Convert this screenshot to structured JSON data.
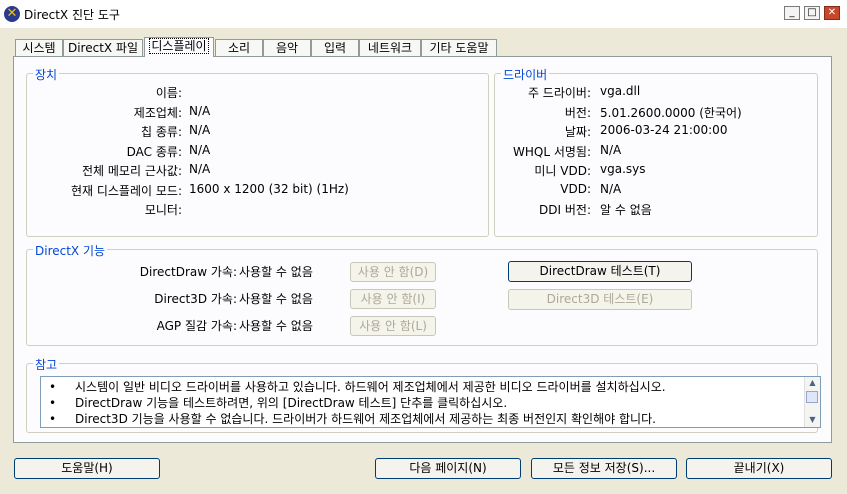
{
  "window": {
    "title": "DirectX 진단 도구",
    "controls": {
      "minimize": "_",
      "maximize": "□",
      "close": "✕"
    }
  },
  "tabs": [
    {
      "label": "시스템"
    },
    {
      "label": "DirectX 파일"
    },
    {
      "label": "디스플레이",
      "active": true
    },
    {
      "label": "소리"
    },
    {
      "label": "음악"
    },
    {
      "label": "입력"
    },
    {
      "label": "네트워크"
    },
    {
      "label": "기타 도움말"
    }
  ],
  "device": {
    "title": "장치",
    "rows": [
      {
        "label": "이름:",
        "value": ""
      },
      {
        "label": "제조업체:",
        "value": "N/A"
      },
      {
        "label": "칩 종류:",
        "value": "N/A"
      },
      {
        "label": "DAC 종류:",
        "value": "N/A"
      },
      {
        "label": "전체 메모리 근사값:",
        "value": "N/A"
      },
      {
        "label": "현재 디스플레이 모드:",
        "value": "1600 x 1200 (32 bit) (1Hz)"
      },
      {
        "label": "모니터:",
        "value": ""
      }
    ]
  },
  "driver": {
    "title": "드라이버",
    "rows": [
      {
        "label": "주 드라이버:",
        "value": "vga.dll"
      },
      {
        "label": "버전:",
        "value": "5.01.2600.0000 (한국어)"
      },
      {
        "label": "날짜:",
        "value": "2006-03-24 21:00:00"
      },
      {
        "label": "WHQL 서명됨:",
        "value": "N/A"
      },
      {
        "label": "미니 VDD:",
        "value": "vga.sys"
      },
      {
        "label": "VDD:",
        "value": "N/A"
      },
      {
        "label": "DDI 버전:",
        "value": "알 수 없음"
      }
    ]
  },
  "features": {
    "title": "DirectX 기능",
    "rows": [
      {
        "label": "DirectDraw 가속:",
        "value": "사용할 수 없음",
        "button": "사용 안 함(D)"
      },
      {
        "label": "Direct3D 가속:",
        "value": "사용할 수 없음",
        "button": "사용 안 함(I)"
      },
      {
        "label": "AGP 질감 가속:",
        "value": "사용할 수 없음",
        "button": "사용 안 함(L)"
      }
    ],
    "test_directdraw": "DirectDraw 테스트(T)",
    "test_direct3d": "Direct3D 테스트(E)"
  },
  "notes": {
    "title": "참고",
    "bullet": "•",
    "lines": [
      "시스템이 일반 비디오 드라이버를 사용하고 있습니다. 하드웨어 제조업체에서 제공한 비디오 드라이버를 설치하십시오.",
      "DirectDraw 기능을 테스트하려면, 위의 [DirectDraw 테스트] 단추를 클릭하십시오.",
      "Direct3D 기능을 사용할 수 없습니다. 드라이버가 하드웨어 제조업체에서 제공하는 최종 버전인지 확인해야 합니다."
    ]
  },
  "footer": {
    "help": "도움말(H)",
    "next_page": "다음 페이지(N)",
    "save_all": "모든 정보 저장(S)...",
    "exit": "끝내기(X)"
  }
}
